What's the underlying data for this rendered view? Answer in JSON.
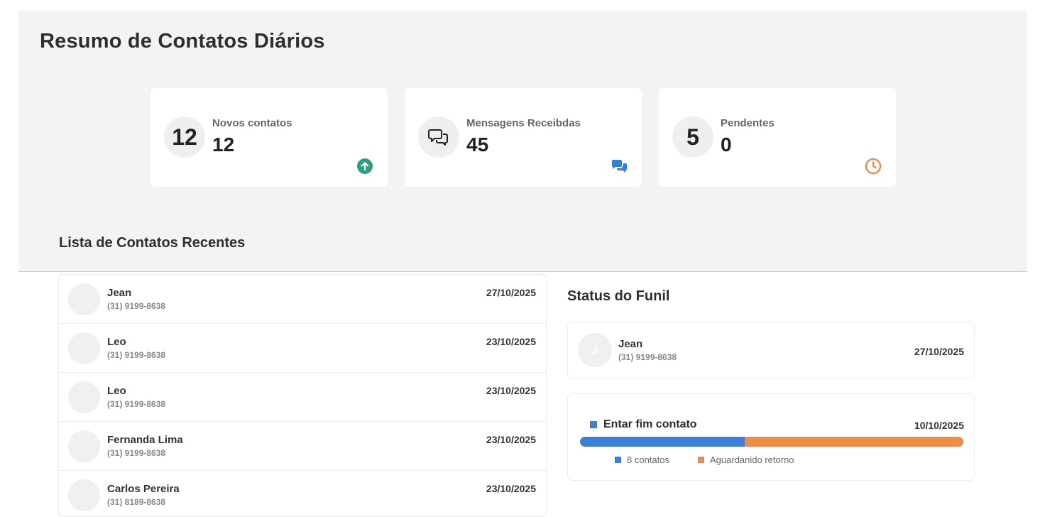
{
  "header": {
    "title": "Resumo de Contatos Diários"
  },
  "stats": [
    {
      "circle_text": "12",
      "label": "Novos contatos",
      "value": "12",
      "corner_icon": "arrow-up-circle-icon",
      "color": "#2e9e7e"
    },
    {
      "circle_icon": "chat-bubbles-icon",
      "label": "Mensagens Receibdas",
      "value": "45",
      "corner_icon": "chat-bubbles-icon",
      "color": "#2f7fe0"
    },
    {
      "circle_text": "5",
      "label": "Pendentes",
      "value": "0",
      "corner_icon": "clock-icon",
      "color": "#ec8a4c"
    }
  ],
  "contacts_section": {
    "title": "Lista de Contatos Recentes"
  },
  "contacts": [
    {
      "name": "Jean",
      "phone": "(31) 9199-8638",
      "date": "27/10/2025"
    },
    {
      "name": "Leo",
      "phone": "(31) 9199-8638",
      "date": "23/10/2025"
    },
    {
      "name": "Leo",
      "phone": "(31) 9199-8638",
      "date": "23/10/2025"
    },
    {
      "name": "Fernanda Lima",
      "phone": "(31) 9199-8638",
      "date": "23/10/2025"
    },
    {
      "name": "Carlos Pereira",
      "phone": "(31) 8189-8638",
      "date": "23/10/2025"
    }
  ],
  "funnel": {
    "title": "Status do Funil",
    "contact": {
      "initial": "J",
      "name": "Jean",
      "phone": "(31) 9199-8638",
      "date": "27/10/2025"
    },
    "stage": {
      "label": "Entar fim contato",
      "date": "10/10/2025",
      "progress_fraction": 0.43,
      "legend": [
        {
          "label": "8 contatos",
          "color": "#3b7fd9"
        },
        {
          "label": "Aguardanido retorno",
          "color": "#ee8c4a"
        }
      ]
    }
  }
}
